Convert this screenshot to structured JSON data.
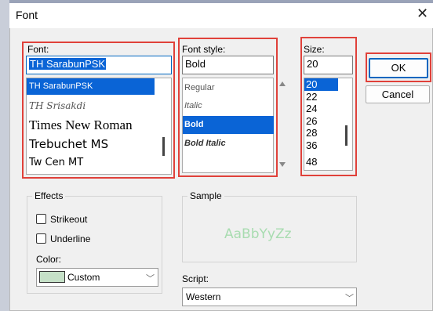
{
  "dialog": {
    "title": "Font"
  },
  "font": {
    "label": "Font:",
    "value": "TH SarabunPSK",
    "options": [
      "TH SarabunPSK",
      "TH Srisakdi",
      "Times New Roman",
      "Trebuchet MS",
      "Tw Cen MT"
    ],
    "selected": "TH SarabunPSK"
  },
  "style": {
    "label": "Font style:",
    "value": "Bold",
    "options": [
      "Regular",
      "Italic",
      "Bold",
      "Bold Italic"
    ],
    "selected": "Bold"
  },
  "size": {
    "label": "Size:",
    "value": "20",
    "options": [
      "20",
      "22",
      "24",
      "26",
      "28",
      "36",
      "48"
    ],
    "selected": "20"
  },
  "buttons": {
    "ok": "OK",
    "cancel": "Cancel"
  },
  "effects": {
    "title": "Effects",
    "strikeout": "Strikeout",
    "strikeout_checked": false,
    "underline": "Underline",
    "underline_checked": false,
    "color_label": "Color:",
    "color_value": "Custom",
    "color_swatch": "#c5e0c7"
  },
  "sample": {
    "title": "Sample",
    "text": "AaBbYyZz"
  },
  "script": {
    "label": "Script:",
    "value": "Western"
  },
  "colors": {
    "highlight": "#0a64d6",
    "red_box": "#e0413a",
    "ok_border": "#0067c0"
  }
}
